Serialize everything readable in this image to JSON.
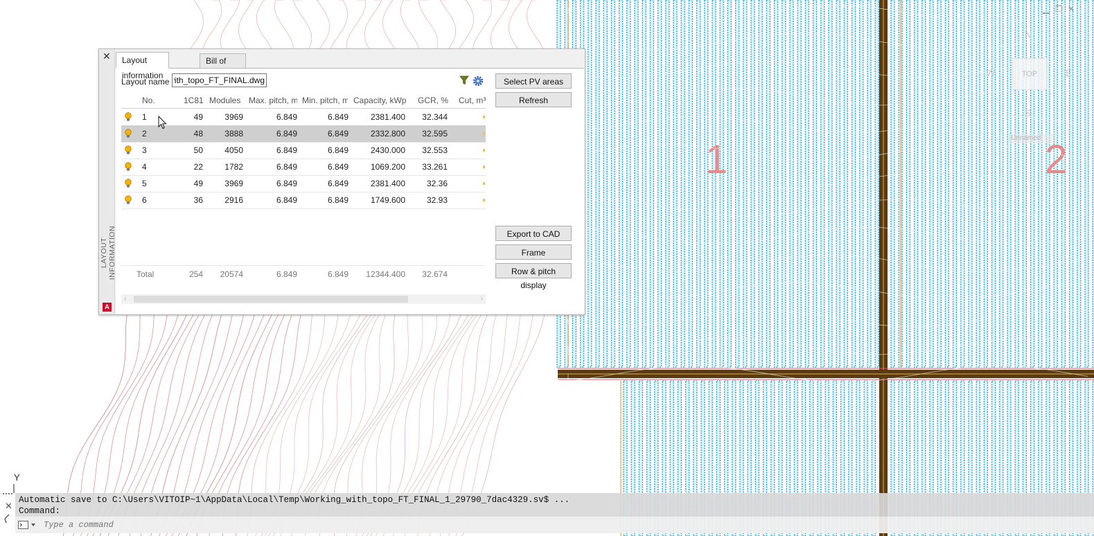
{
  "drawing": {
    "area_labels": [
      "1",
      "2"
    ],
    "ucs_axis_label": "Y",
    "accent_cyan": "#1f9fd4",
    "road_color": "#5a3a10",
    "contour_color": "#d98a8a"
  },
  "viewcube": {
    "north": "N",
    "south": "S",
    "west": "W",
    "east": "E",
    "face": "TOP",
    "wcs": "Unnamed"
  },
  "palette": {
    "vertical_title": "LAYOUT INFORMATION",
    "logo_letter": "A",
    "tabs": [
      {
        "label": "Layout information",
        "active": true
      },
      {
        "label": "Bill of Materials",
        "active": false
      }
    ],
    "layout_name_label": "Layout name",
    "layout_name_value": "Working_with_topo_FT_FINAL.dwg",
    "buttons": {
      "select_pv": "Select PV areas",
      "refresh": "Refresh",
      "export_cad": "Export to CAD",
      "frame_info": "Frame information",
      "row_pitch": "Row & pitch display"
    },
    "columns": [
      "No.",
      "1C81",
      "Modules",
      "Max. pitch, m",
      "Min. pitch, m",
      "Capacity, kWp",
      "GCR, %",
      "Cut, m³"
    ],
    "rows": [
      {
        "no": "1",
        "c81": "49",
        "modules": "3969",
        "max_pitch": "6.849",
        "min_pitch": "6.849",
        "capacity": "2381.400",
        "gcr": "32.344"
      },
      {
        "no": "2",
        "c81": "48",
        "modules": "3888",
        "max_pitch": "6.849",
        "min_pitch": "6.849",
        "capacity": "2332.800",
        "gcr": "32.595"
      },
      {
        "no": "3",
        "c81": "50",
        "modules": "4050",
        "max_pitch": "6.849",
        "min_pitch": "6.849",
        "capacity": "2430.000",
        "gcr": "32.553"
      },
      {
        "no": "4",
        "c81": "22",
        "modules": "1782",
        "max_pitch": "6.849",
        "min_pitch": "6.849",
        "capacity": "1069.200",
        "gcr": "33.261"
      },
      {
        "no": "5",
        "c81": "49",
        "modules": "3969",
        "max_pitch": "6.849",
        "min_pitch": "6.849",
        "capacity": "2381.400",
        "gcr": "32.36"
      },
      {
        "no": "6",
        "c81": "36",
        "modules": "2916",
        "max_pitch": "6.849",
        "min_pitch": "6.849",
        "capacity": "1749.600",
        "gcr": "32.93"
      }
    ],
    "selected_row": 2,
    "total": {
      "label": "Total",
      "c81": "254",
      "modules": "20574",
      "max_pitch": "6.849",
      "min_pitch": "6.849",
      "capacity": "12344.400",
      "gcr": "32.674"
    }
  },
  "command_line": {
    "history": [
      "Automatic save to C:\\Users\\VITOIP~1\\AppData\\Local\\Temp\\Working_with_topo_FT_FINAL_1_29790_7dac4329.sv$ ...",
      "Command:"
    ],
    "placeholder": "Type a command"
  }
}
